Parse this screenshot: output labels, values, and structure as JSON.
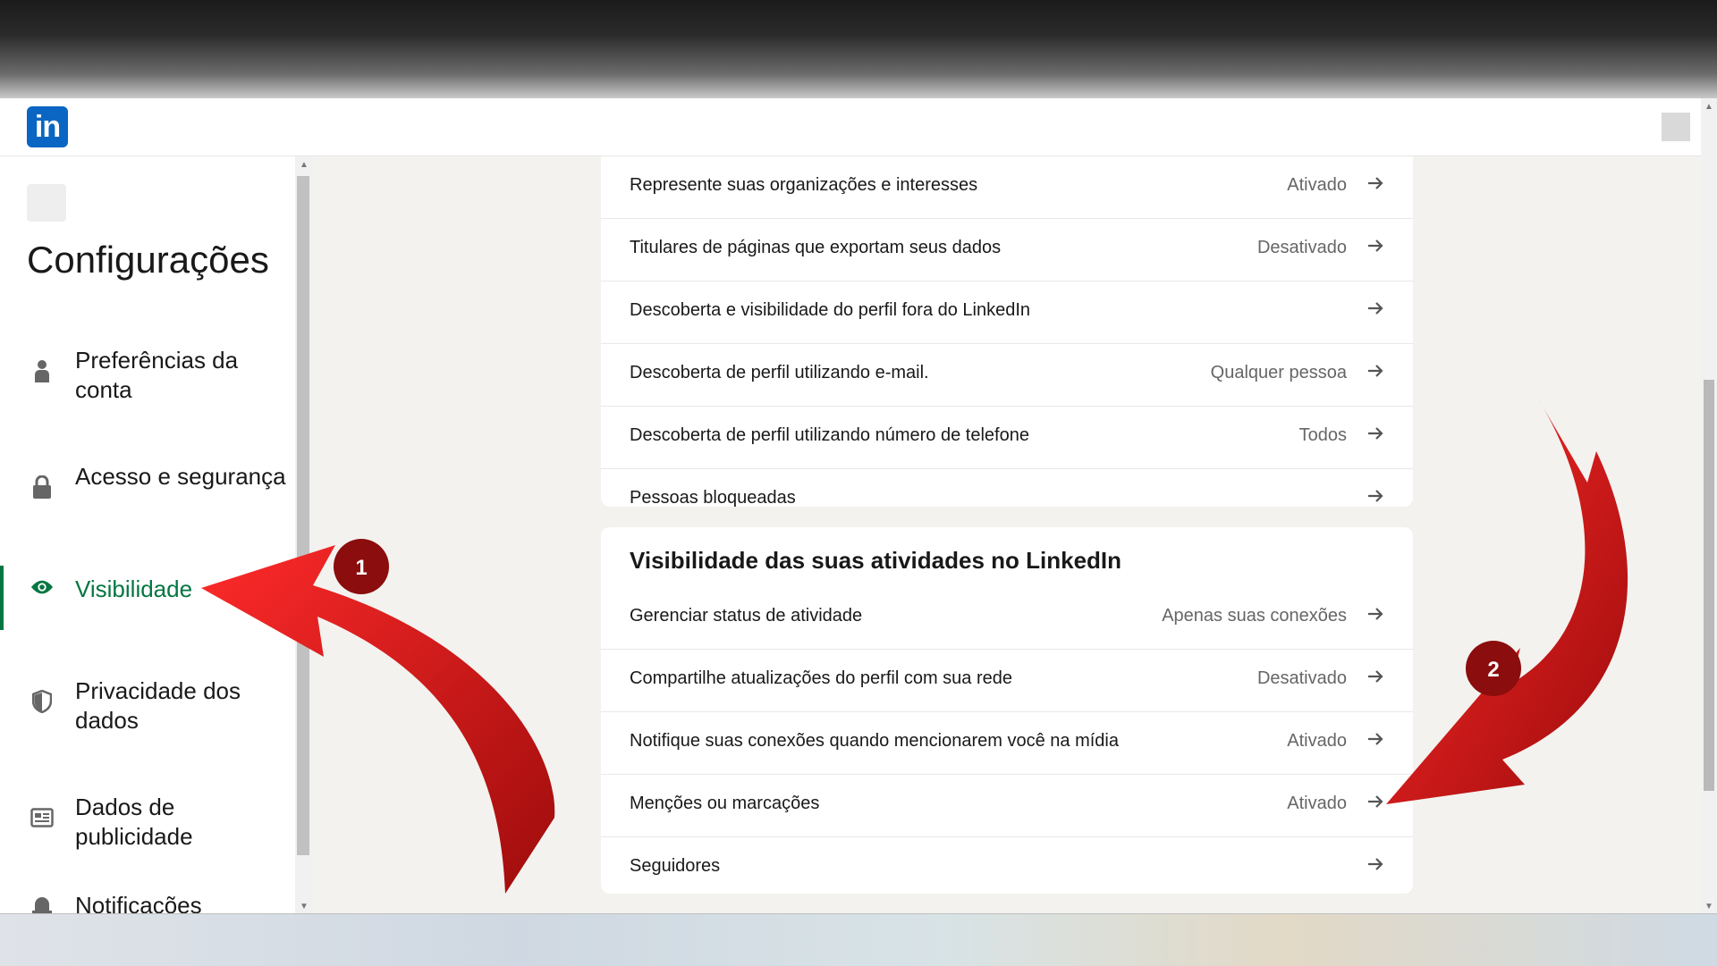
{
  "header": {
    "logo_text": "in"
  },
  "sidebar": {
    "title": "Configurações",
    "items": [
      {
        "label": "Preferências da conta",
        "icon": "person-icon"
      },
      {
        "label": "Acesso e segurança",
        "icon": "lock-icon"
      },
      {
        "label": "Visibilidade",
        "icon": "eye-icon",
        "active": true
      },
      {
        "label": "Privacidade dos dados",
        "icon": "shield-icon"
      },
      {
        "label": "Dados de publicidade",
        "icon": "newspaper-icon"
      },
      {
        "label": "Notificações",
        "icon": "bell-icon"
      }
    ]
  },
  "section1": {
    "rows": [
      {
        "label": "Represente suas organizações e interesses",
        "value": "Ativado"
      },
      {
        "label": "Titulares de páginas que exportam seus dados",
        "value": "Desativado"
      },
      {
        "label": "Descoberta e visibilidade do perfil fora do LinkedIn",
        "value": ""
      },
      {
        "label": "Descoberta de perfil utilizando e-mail.",
        "value": "Qualquer pessoa"
      },
      {
        "label": "Descoberta de perfil utilizando número de telefone",
        "value": "Todos"
      },
      {
        "label": "Pessoas bloqueadas",
        "value": ""
      }
    ]
  },
  "section2": {
    "title": "Visibilidade das suas atividades no LinkedIn",
    "rows": [
      {
        "label": "Gerenciar status de atividade",
        "value": "Apenas suas conexões"
      },
      {
        "label": "Compartilhe atualizações do perfil com sua rede",
        "value": "Desativado"
      },
      {
        "label": "Notifique suas conexões quando mencionarem você na mídia",
        "value": "Ativado"
      },
      {
        "label": "Menções ou marcações",
        "value": "Ativado"
      },
      {
        "label": "Seguidores",
        "value": ""
      }
    ]
  },
  "annotations": {
    "badge1": "1",
    "badge2": "2"
  },
  "colors": {
    "accent_green": "#057642",
    "brand_blue": "#0a66c2",
    "annotation_red": "#d41515",
    "badge": "#8b0d0d"
  }
}
